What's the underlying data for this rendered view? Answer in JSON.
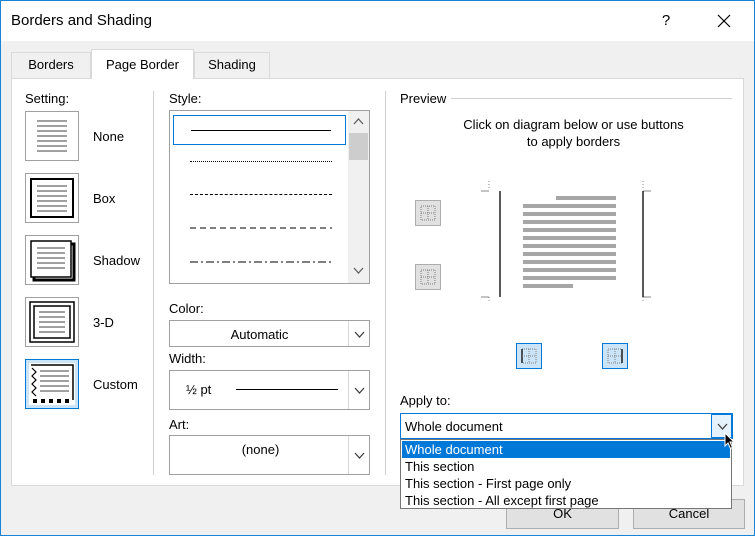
{
  "window": {
    "title": "Borders and Shading",
    "help_label": "?"
  },
  "tabs": [
    {
      "label": "Borders",
      "active": false
    },
    {
      "label": "Page Border",
      "active": true
    },
    {
      "label": "Shading",
      "active": false
    }
  ],
  "setting": {
    "heading": "Setting:",
    "options": [
      {
        "label": "None",
        "icon": "setting-none-icon"
      },
      {
        "label": "Box",
        "icon": "setting-box-icon"
      },
      {
        "label": "Shadow",
        "icon": "setting-shadow-icon"
      },
      {
        "label": "3-D",
        "icon": "setting-3d-icon"
      },
      {
        "label": "Custom",
        "icon": "setting-custom-icon",
        "selected": true
      }
    ]
  },
  "style": {
    "heading": "Style:",
    "items": [
      "solid",
      "dotted",
      "dashed-small",
      "dashed-large",
      "dash-dot"
    ],
    "selected_index": 0
  },
  "color": {
    "label": "Color:",
    "value": "Automatic"
  },
  "width": {
    "label": "Width:",
    "value": "½ pt"
  },
  "art": {
    "label": "Art:",
    "value": "(none)"
  },
  "preview": {
    "heading": "Preview",
    "instruction_line1": "Click on diagram below or use buttons",
    "instruction_line2": "to apply borders"
  },
  "apply_to": {
    "label": "Apply to:",
    "value": "Whole document",
    "options": [
      "Whole document",
      "This section",
      "This section - First page only",
      "This section - All except first page"
    ],
    "selected_index": 0
  },
  "buttons": {
    "ok": "OK",
    "cancel": "Cancel"
  },
  "colors": {
    "accent": "#0078d7",
    "title_border": "#1883d7"
  }
}
